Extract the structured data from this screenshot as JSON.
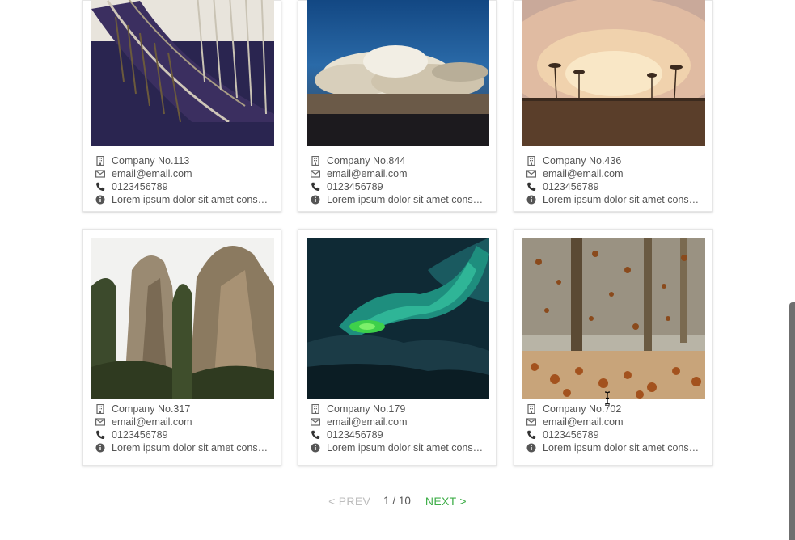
{
  "cards": [
    {
      "company": "Company No.113",
      "email": "email@email.com",
      "phone": "0123456789",
      "desc": "Lorem ipsum dolor sit amet consectetur adipiscing elit",
      "image": "library-bookshelves"
    },
    {
      "company": "Company No.844",
      "email": "email@email.com",
      "phone": "0123456789",
      "desc": "Lorem ipsum dolor sit amet consectetur adipiscing elit",
      "image": "storm-clouds"
    },
    {
      "company": "Company No.436",
      "email": "email@email.com",
      "phone": "0123456789",
      "desc": "Lorem ipsum dolor sit amet consectetur adipiscing elit",
      "image": "sunset-palms"
    },
    {
      "company": "Company No.317",
      "email": "email@email.com",
      "phone": "0123456789",
      "desc": "Lorem ipsum dolor sit amet consectetur adipiscing elit",
      "image": "rock-cliffs"
    },
    {
      "company": "Company No.179",
      "email": "email@email.com",
      "phone": "0123456789",
      "desc": "Lorem ipsum dolor sit amet consectetur adipiscing elit",
      "image": "aurora-borealis"
    },
    {
      "company": "Company No.702",
      "email": "email@email.com",
      "phone": "0123456789",
      "desc": "Lorem ipsum dolor sit amet consectetur adipiscing elit",
      "image": "autumn-leaves"
    }
  ],
  "icons": {
    "company": "building-icon",
    "email": "envelope-icon",
    "phone": "phone-icon",
    "info": "info-circle-icon"
  },
  "pagination": {
    "prev_label": "< PREV",
    "page_indicator": "1 / 10",
    "next_label": "NEXT >"
  },
  "colors": {
    "accent": "#3fae49",
    "disabled": "#bdbdbd",
    "text": "#555555"
  }
}
